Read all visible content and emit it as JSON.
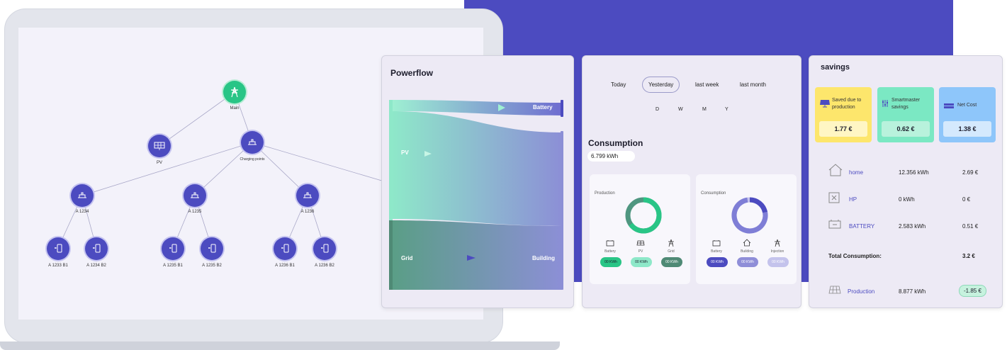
{
  "tree": {
    "main": "Main",
    "pv": "PV",
    "charging_points": "Charging points",
    "groups": [
      "A 1234",
      "A 1235",
      "A 1236"
    ],
    "leaves": [
      "A 1233 B1",
      "A 1234 B2",
      "A 1235 B1",
      "A 1235 B2",
      "A 1236 B1",
      "A 1236 B2"
    ]
  },
  "powerflow": {
    "title": "Powerflow",
    "battery": "Battery",
    "pv": "PV",
    "grid": "Grid",
    "building": "Building"
  },
  "consumption_card": {
    "periods": [
      "Today",
      "Yesterday",
      "last week",
      "last month"
    ],
    "selected_period": "Yesterday",
    "granularity": [
      "D",
      "W",
      "M",
      "Y"
    ],
    "title": "Consumption",
    "total": "6.799 kWh",
    "production_panel": {
      "title": "Production",
      "items": [
        {
          "label": "Battery",
          "value": "00 KWh"
        },
        {
          "label": "PV",
          "value": "00 KWh"
        },
        {
          "label": "Grid",
          "value": "00 KWh"
        }
      ]
    },
    "consumption_panel": {
      "title": "Consumption",
      "items": [
        {
          "label": "Battery",
          "value": "00 KWh"
        },
        {
          "label": "Building",
          "value": "00 KWh"
        },
        {
          "label": "Injection",
          "value": "00 KWh"
        }
      ]
    }
  },
  "savings": {
    "title": "savings",
    "boxes": [
      {
        "label": "Saved due to production",
        "value": "1.77 €"
      },
      {
        "label": "Smartmaster savings",
        "value": "0.62 €"
      },
      {
        "label": "Net Cost",
        "value": "1.38 €"
      }
    ],
    "rows": [
      {
        "label": "home",
        "kwh": "12.356 kWh",
        "cost": "2.69 €"
      },
      {
        "label": "HP",
        "kwh": "0 kWh",
        "cost": "0 €"
      },
      {
        "label": "BATTERY",
        "kwh": "2.583 kWh",
        "cost": "0.51 €"
      }
    ],
    "total_label": "Total Consumption:",
    "total_value": "3.2 €",
    "production_label": "Production",
    "production_kwh": "8.877 kWh",
    "production_value": "-1.85 €"
  },
  "colors": {
    "accent": "#4c4bc0",
    "green": "#29c586",
    "yellow": "#fde66c",
    "mint": "#7be8c3",
    "blue": "#8ec6fa"
  }
}
